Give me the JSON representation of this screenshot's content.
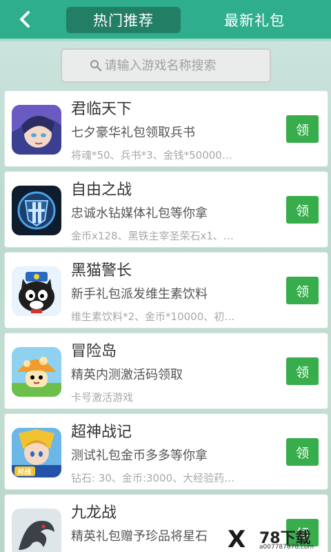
{
  "header": {
    "tabs": [
      {
        "label": "热门推荐",
        "active": true
      },
      {
        "label": "最新礼包",
        "active": false
      }
    ]
  },
  "search": {
    "placeholder": "请输入游戏名称搜索"
  },
  "games": [
    {
      "name": "君临天下",
      "gift_title": "七夕豪华礼包领取兵书",
      "gift_desc": "将魂*50、兵书*3、金钱*50000…",
      "button": "领",
      "icon": "hero-avatar-icon"
    },
    {
      "name": "自由之战",
      "gift_title": "忠诚水钻媒体礼包等你拿",
      "gift_desc": "金币x128、黑铁主宰圣荣石x1、…",
      "button": "领",
      "icon": "shield-emblem-icon"
    },
    {
      "name": "黑猫警长",
      "gift_title": "新手礼包派发维生素饮料",
      "gift_desc": "维生素饮料*2、金币*10000、初…",
      "button": "领",
      "icon": "black-cat-icon"
    },
    {
      "name": "冒险岛",
      "gift_title": "精英内测激活码领取",
      "gift_desc": "卡号激活游戏",
      "button": "领",
      "icon": "mushroom-icon"
    },
    {
      "name": "超神战记",
      "gift_title": "测试礼包金币多多等你拿",
      "gift_desc": "钻石: 30、金币:3000、大经验药…",
      "button": "领",
      "icon": "warrior-icon"
    },
    {
      "name": "九龙战",
      "gift_title": "精英礼包赠予珍品将星石",
      "gift_desc": "",
      "button": "领",
      "icon": "dragon-icon"
    }
  ],
  "watermark": {
    "brand": "78下载",
    "url": "a007787878.com"
  },
  "colors": {
    "header": "#2fae8d",
    "active_tab": "#237e66",
    "claim_button": "#37ad4b"
  }
}
